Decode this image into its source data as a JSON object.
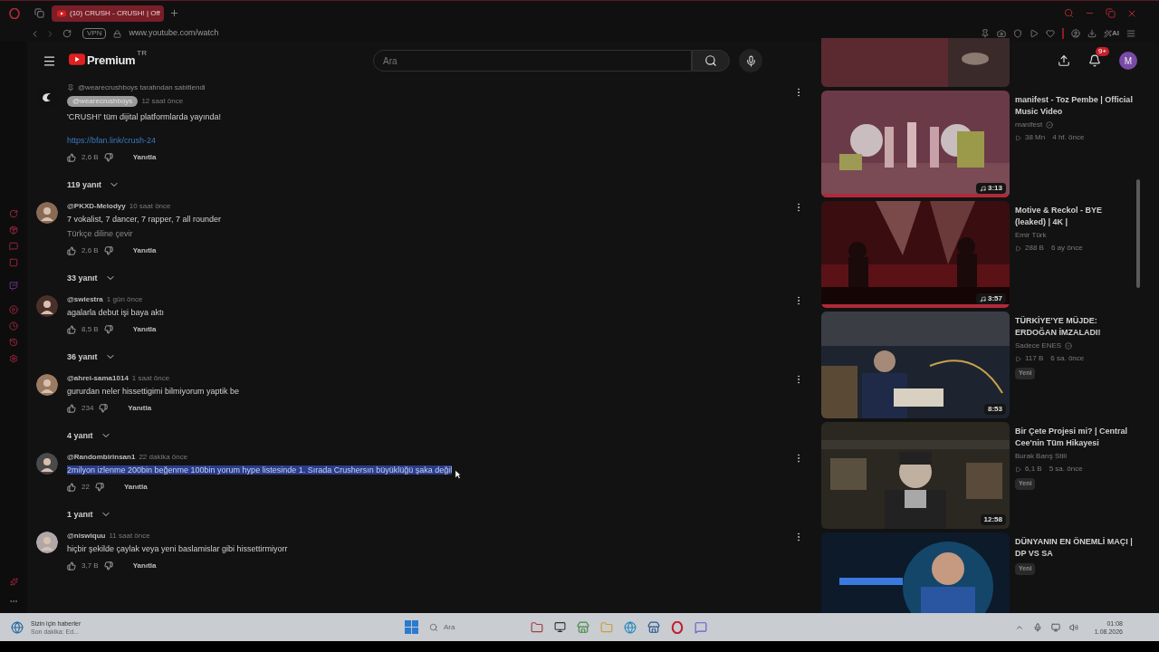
{
  "browser": {
    "tab": {
      "title": "(10) CRUSH - CRUSH! | Off",
      "selected": true
    },
    "vpn": "VPN",
    "url": "www.youtube.com/watch",
    "ai_label": "AI"
  },
  "header": {
    "logo": "Premium",
    "region": "TR",
    "search": {
      "placeholder": "Ara"
    },
    "notifications": "9+",
    "avatar": "M"
  },
  "comments": [
    {
      "kind": "pinned",
      "pinned_by": "@wearecrushboys tarafından sabitlendi",
      "author": "@wearecrushboys",
      "time": "12 saat önce",
      "text": "'CRUSH!' tüm dijital platformlarda yayında!",
      "link": "https://bfan.link/crush-24",
      "likes": "2,6 B",
      "reply": "Yanıtla",
      "replies": "119 yanıt",
      "selected": false
    },
    {
      "kind": "normal",
      "author": "@PKXD-Melodyy",
      "time": "10 saat önce",
      "text": "7 vokalist, 7 dancer, 7 rapper, 7 all rounder",
      "translate": "Türkçe diline çevir",
      "likes": "2,6 B",
      "reply": "Yanıtla",
      "replies": "33 yanıt",
      "selected": false
    },
    {
      "kind": "normal",
      "author": "@swiestra",
      "time": "1 gün önce",
      "text": "agalarla debut işi baya aktı",
      "likes": "8,5 B",
      "reply": "Yanıtla",
      "replies": "36 yanıt",
      "selected": false
    },
    {
      "kind": "normal",
      "author": "@ahrei-sama1014",
      "time": "1 saat önce",
      "text": "gururdan neler hissettigimi bilmiyorum yaptik be",
      "likes": "234",
      "reply": "Yanıtla",
      "replies": "4 yanıt",
      "selected": false
    },
    {
      "kind": "normal",
      "author": "@Randombirinsan1",
      "time": "22 dakika önce",
      "text": "2milyon izlenme 200bin beğenme 100bin yorum hype listesinde 1. Sırada Crushersın büyüklüğü şaka değil",
      "likes": "22",
      "reply": "Yanıtla",
      "replies": "1 yanıt",
      "selected": true
    },
    {
      "kind": "normal",
      "author": "@niswiquu",
      "time": "11 saat önce",
      "text": "hiçbir şekilde çaylak veya yeni baslamislar gibi hissettirmiyorr",
      "likes": "3,7 B",
      "reply": "Yanıtla",
      "selected": false
    }
  ],
  "recommendations": [
    {
      "title": "manifest - Toz Pembe | Official Music Video",
      "channel": "manifest",
      "verified": true,
      "views": "38 Mn",
      "age": "4 hf. önce",
      "duration": "3:13",
      "music": true
    },
    {
      "title": "Motive & Reckol - BYE (leaked) | 4K |",
      "channel": "Emir Türk",
      "verified": false,
      "views": "288 B",
      "age": "6 ay önce",
      "duration": "3:57",
      "music": true
    },
    {
      "title": "TÜRKİYE'YE MÜJDE: ERDOĞAN İMZALADI!",
      "channel": "Sadece ENES",
      "verified": true,
      "views": "117 B",
      "age": "6 sa. önce",
      "badge": "Yeni",
      "duration": "8:53",
      "music": false
    },
    {
      "title": "Bir Çete Projesi mi? | Central Cee'nin Tüm Hikayesi",
      "channel": "Burak Barış Stili",
      "verified": false,
      "views": "6,1 B",
      "age": "5 sa. önce",
      "badge": "Yeni",
      "duration": "12:58",
      "music": false
    },
    {
      "title": "DÜNYANIN EN ÖNEMLİ MAÇI | DP VS SA",
      "badge": "Yeni"
    }
  ],
  "taskbar": {
    "news_title": "Sizin için haberler",
    "news_sub": "Son dakika: Ed...",
    "search": "Ara",
    "time": "01:08",
    "date": "1.08.2026"
  }
}
